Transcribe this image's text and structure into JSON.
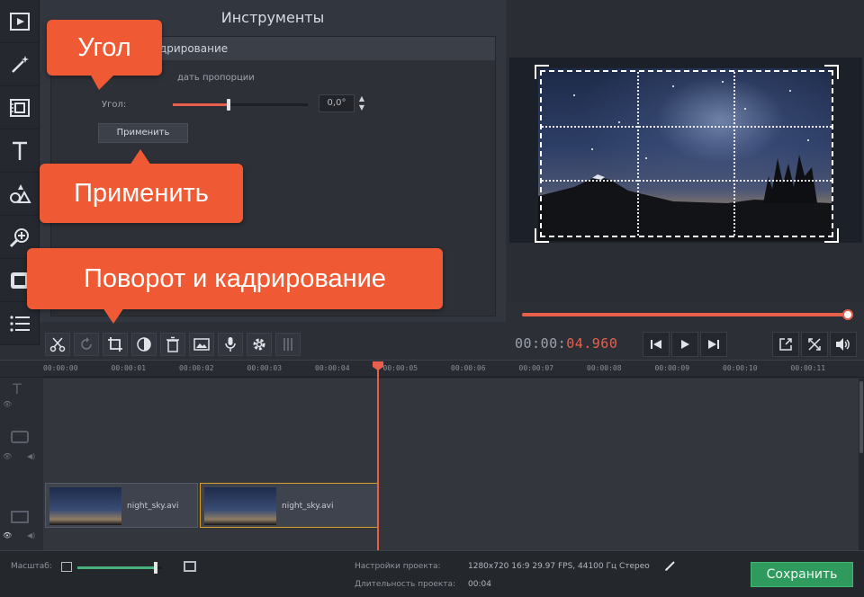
{
  "rail": {
    "icons": [
      "video-file-icon",
      "magic-wand-icon",
      "film-filter-icon",
      "text-icon",
      "shapes-icon",
      "zoom-icon",
      "record-icon",
      "list-icon"
    ]
  },
  "tools_panel": {
    "title": "Инструменты",
    "tool_header": "дрирование",
    "keep_ratio_label": "дать пропорции",
    "angle_label": "Угол:",
    "angle_value": "0,0°",
    "angle_slider_fraction": 0.5,
    "apply_label": "Применить"
  },
  "callouts": {
    "angle": "Угол",
    "apply": "Применить",
    "rotate_crop": "Поворот и кадрирование"
  },
  "preview": {
    "progress_fraction": 1.0
  },
  "toolbar": {
    "icons": [
      "scissors-icon",
      "rotate-icon",
      "crop-icon",
      "color-adjust-icon",
      "trash-icon",
      "image-icon",
      "microphone-icon",
      "gear-icon",
      "equalizer-icon"
    ],
    "timecode_gray": "00:00:",
    "timecode_red": "04.960"
  },
  "ruler": {
    "ticks": [
      "00:00:00",
      "00:00:01",
      "00:00:02",
      "00:00:03",
      "00:00:04",
      "00:00:05",
      "00:00:06",
      "00:00:07",
      "00:00:08",
      "00:00:09",
      "00:00:10",
      "00:00:11"
    ]
  },
  "timeline": {
    "clips": [
      {
        "name": "night_sky.avi",
        "selected": false
      },
      {
        "name": "night_sky.avi",
        "selected": true
      }
    ]
  },
  "bottom": {
    "zoom_label": "Масштаб:",
    "zoom_fraction": 0.95,
    "settings_label": "Настройки проекта:",
    "settings_value": "1280x720 16:9 29.97 FPS, 44100 Гц Стерео",
    "duration_label": "Длительность проекта:",
    "duration_value": "00:04",
    "save_label": "Сохранить"
  },
  "colors": {
    "accent": "#e8604c",
    "callout": "#ef5a35",
    "save": "#2f9a5d"
  }
}
